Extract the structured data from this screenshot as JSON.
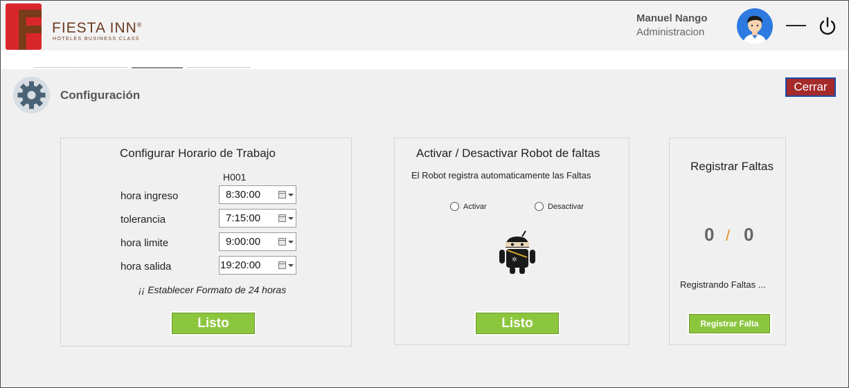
{
  "brand": {
    "name": "FIESTA INN",
    "reg_mark": "®",
    "tagline": "HOTELES BUSINESS CLASS"
  },
  "user": {
    "name": "Manuel Nango",
    "role": "Administracion"
  },
  "page": {
    "title": "Configuración",
    "close_label": "Cerrar"
  },
  "schedule_panel": {
    "title": "Configurar Horario de Trabajo",
    "column_header": "H001",
    "rows": [
      {
        "label": "hora ingreso",
        "value": "8:30:00"
      },
      {
        "label": "tolerancia",
        "value": "7:15:00"
      },
      {
        "label": "hora limite",
        "value": "9:00:00"
      },
      {
        "label": "hora salida",
        "value": "19:20:00"
      }
    ],
    "hint": "¡¡ Establecer Formato de 24 horas",
    "button_label": "Listo"
  },
  "robot_panel": {
    "title": "Activar / Desactivar Robot de faltas",
    "subtitle": "El Robot registra automaticamente las Faltas",
    "options": [
      "Activar",
      "Desactivar"
    ],
    "button_label": "Listo"
  },
  "absences_panel": {
    "title": "Registrar Faltas",
    "count_done": "0",
    "separator": "/",
    "count_total": "0",
    "status": "Registrando Faltas ...",
    "button_label": "Registrar Falta"
  },
  "colors": {
    "accent_green": "#8cc63f",
    "close_red": "#a52a2a",
    "brand_red": "#d9262b",
    "brand_brown": "#7a3b1a"
  }
}
